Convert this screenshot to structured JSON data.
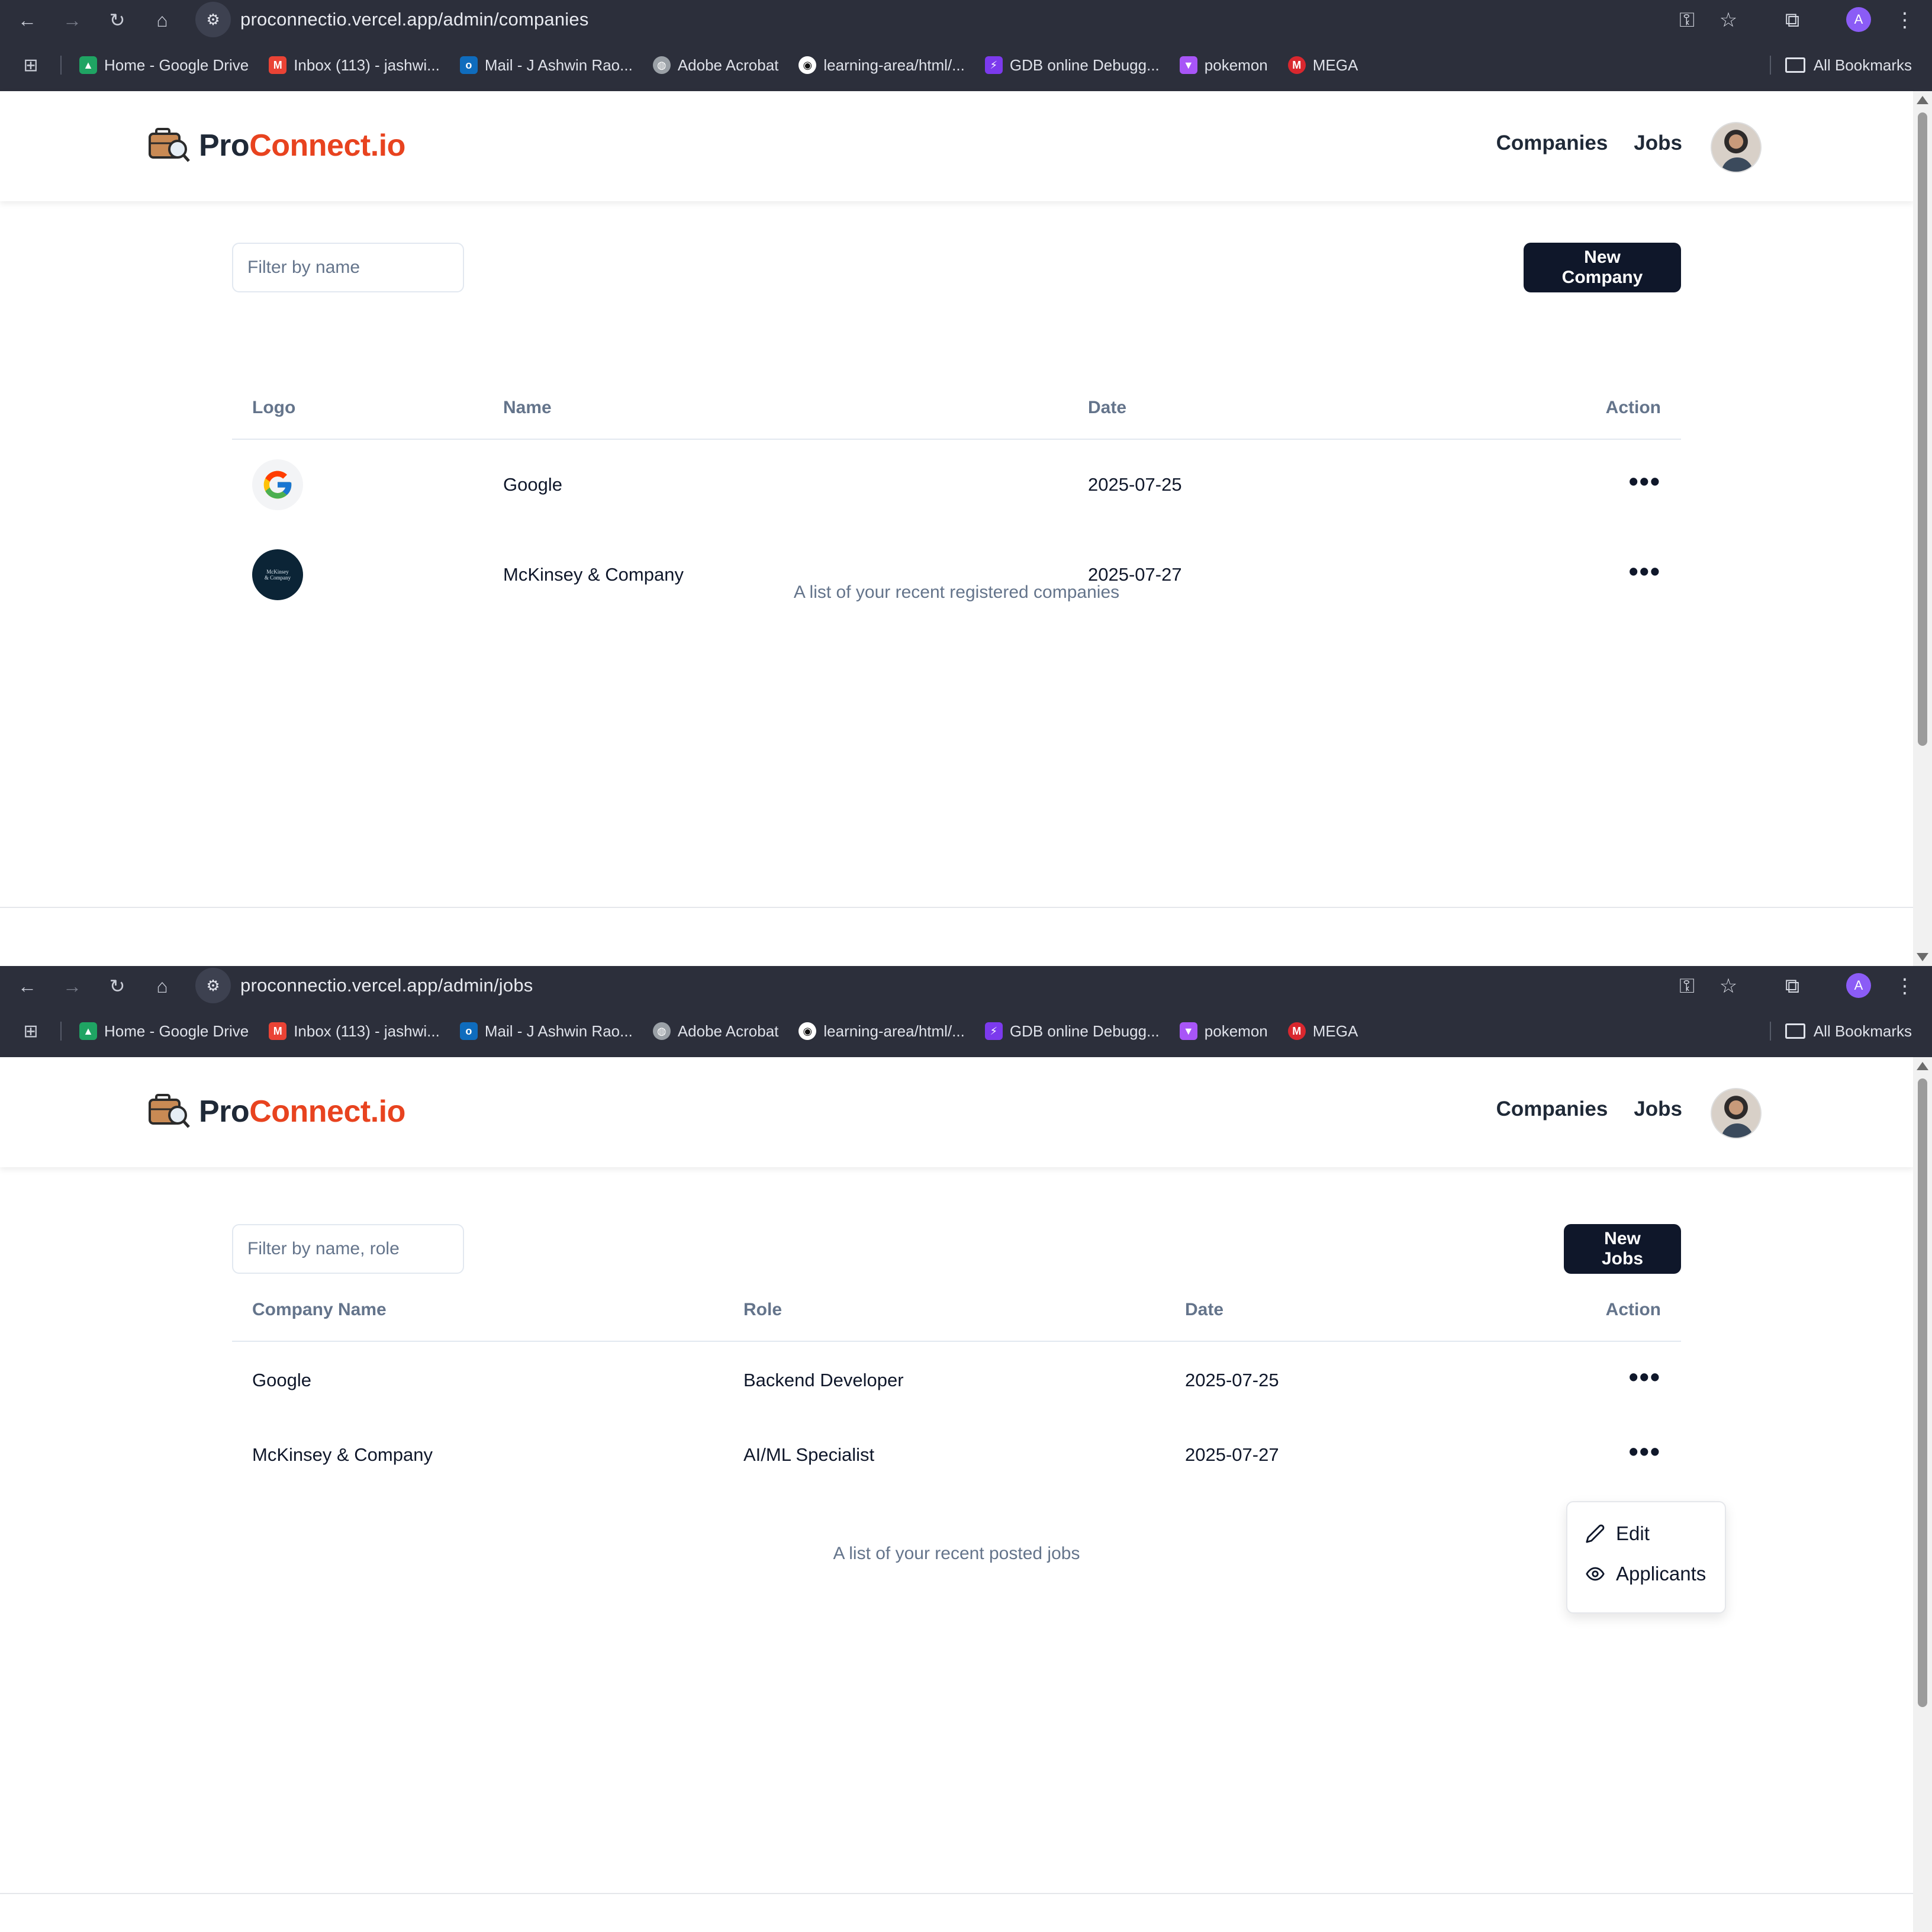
{
  "browser": {
    "bookmarks": [
      {
        "label": "Home - Google Drive",
        "icon": "google-drive-icon",
        "color": "#1fa463"
      },
      {
        "label": "Inbox (113) - jashwi...",
        "icon": "gmail-icon",
        "color": "#ea4335"
      },
      {
        "label": "Mail - J Ashwin Rao...",
        "icon": "outlook-icon",
        "color": "#0f6cbd"
      },
      {
        "label": "Adobe Acrobat",
        "icon": "globe-icon",
        "color": "#9aa0a6"
      },
      {
        "label": "learning-area/html/...",
        "icon": "github-icon",
        "color": "#ffffff"
      },
      {
        "label": "GDB online Debugg...",
        "icon": "bolt-icon",
        "color": "#7c3aed"
      },
      {
        "label": "pokemon",
        "icon": "vite-icon",
        "color": "#a855f7"
      },
      {
        "label": "MEGA",
        "icon": "mega-icon",
        "color": "#d9272e"
      }
    ],
    "all_bookmarks": "All Bookmarks",
    "profile_initial": "A"
  },
  "brand": {
    "pro": "Pro",
    "connect": "Connect.io",
    "accent": "#e8431f"
  },
  "nav": {
    "companies": "Companies",
    "jobs": "Jobs"
  },
  "window1": {
    "url": "proconnectio.vercel.app/admin/companies",
    "filter_placeholder": "Filter by name",
    "new_button": "New Company",
    "columns": {
      "logo": "Logo",
      "name": "Name",
      "date": "Date",
      "action": "Action"
    },
    "rows": [
      {
        "name": "Google",
        "date": "2025-07-25",
        "logo": "google-logo"
      },
      {
        "name": "McKinsey & Company",
        "date": "2025-07-27",
        "logo": "mckinsey-logo"
      }
    ],
    "caption": "A list of your recent registered companies"
  },
  "window2": {
    "url": "proconnectio.vercel.app/admin/jobs",
    "filter_placeholder": "Filter by name, role",
    "new_button": "New Jobs",
    "columns": {
      "company": "Company Name",
      "role": "Role",
      "date": "Date",
      "action": "Action"
    },
    "rows": [
      {
        "company": "Google",
        "role": "Backend Developer",
        "date": "2025-07-25"
      },
      {
        "company": "McKinsey & Company",
        "role": "AI/ML Specialist",
        "date": "2025-07-27"
      }
    ],
    "caption": "A list of your recent posted jobs",
    "menu": {
      "edit": "Edit",
      "applicants": "Applicants"
    }
  },
  "action_dots": "•••"
}
